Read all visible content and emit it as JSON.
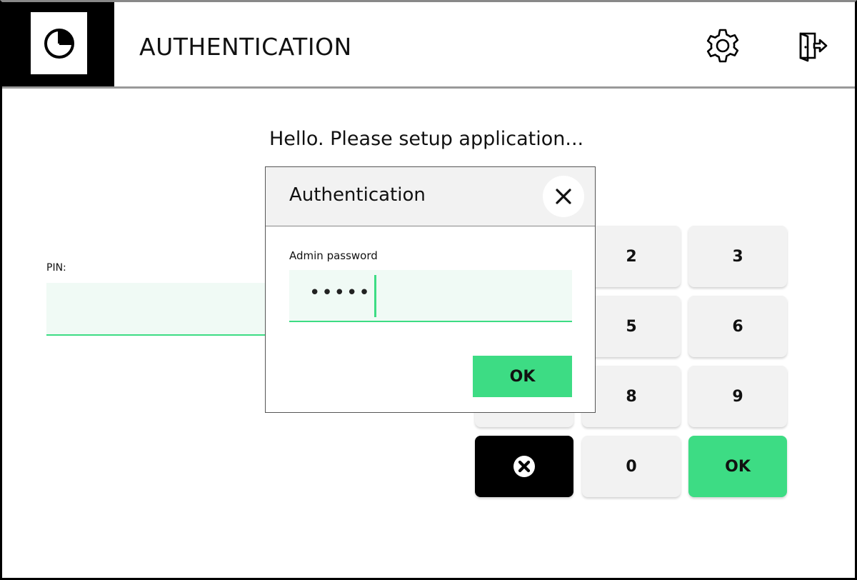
{
  "header": {
    "title": "AUTHENTICATION",
    "logo_icon": "pie-chart-icon",
    "settings_icon": "gear-icon",
    "logout_icon": "exit-door-icon"
  },
  "main": {
    "greeting": "Hello. Please setup application...",
    "pin_label": "PIN:",
    "pin_value": ""
  },
  "keypad": {
    "keys": [
      "2",
      "3",
      "5",
      "6",
      "8",
      "9",
      "0",
      "OK"
    ],
    "delete_icon": "clear-circle-x-icon"
  },
  "dialog": {
    "title": "Authentication",
    "close_icon": "close-icon",
    "field_label": "Admin password",
    "field_value": "•••••",
    "ok_label": "OK"
  },
  "colors": {
    "accent": "#3ddc84",
    "field_bg": "#f0faf5",
    "key_bg": "#f2f2f2",
    "header_left": "#000000"
  }
}
